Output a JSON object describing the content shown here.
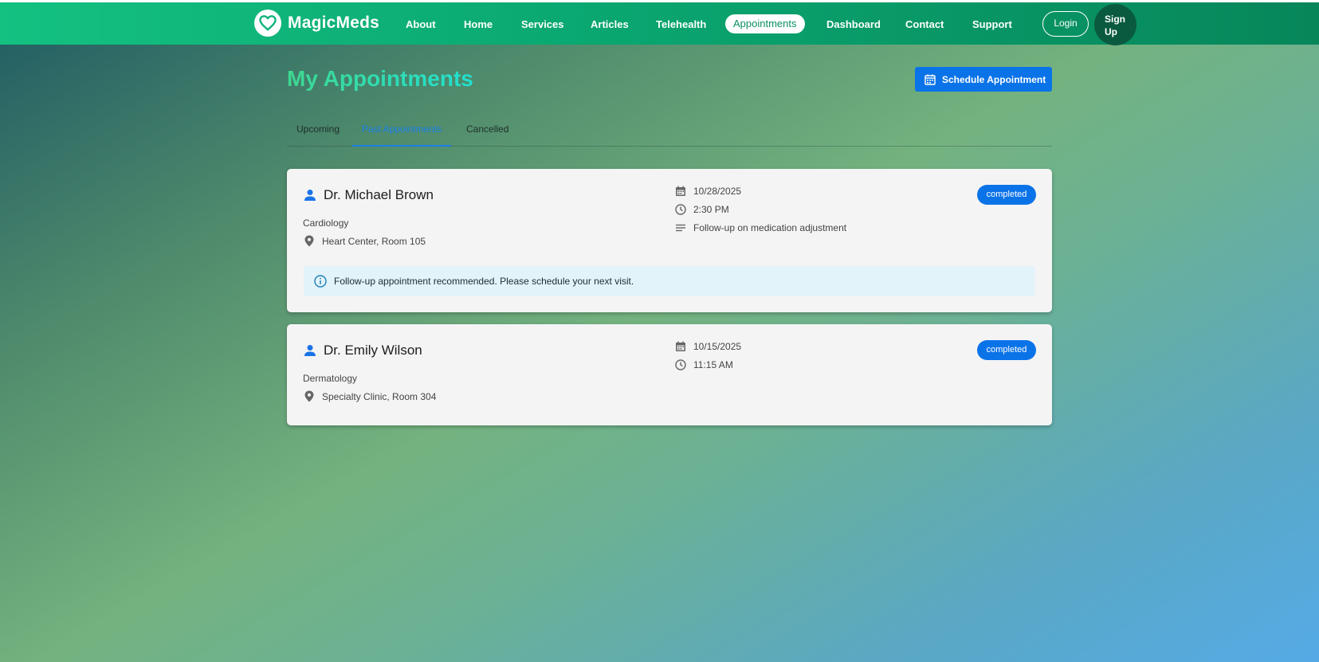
{
  "brand": {
    "name": "MagicMeds",
    "logo_icon": "heart-icon"
  },
  "nav": {
    "links": [
      "About",
      "Home",
      "Services",
      "Articles",
      "Telehealth",
      "Appointments",
      "Dashboard",
      "Contact",
      "Support"
    ],
    "active": "Appointments",
    "login_label": "Login",
    "signup_label_line1": "Sign",
    "signup_label_line2": "Up"
  },
  "page": {
    "title": "My Appointments",
    "schedule_button": "Schedule Appointment",
    "schedule_icon": "calendar-icon"
  },
  "tabs": {
    "items": [
      "Upcoming",
      "Past Appointments",
      "Cancelled"
    ],
    "active": "Past Appointments"
  },
  "appointments": [
    {
      "doctor": "Dr. Michael Brown",
      "specialty": "Cardiology",
      "location": "Heart Center, Room 105",
      "date": "10/28/2025",
      "time": "2:30 PM",
      "reason": "Follow-up on medication adjustment",
      "status": "completed",
      "note": "Follow-up appointment recommended. Please schedule your next visit."
    },
    {
      "doctor": "Dr. Emily Wilson",
      "specialty": "Dermatology",
      "location": "Specialty Clinic, Room 304",
      "date": "10/15/2025",
      "time": "11:15 AM",
      "status": "completed"
    }
  ],
  "colors": {
    "primary": "#0b73e8",
    "nav_green": "#0aa771",
    "title_gradient_start": "#3ed891",
    "title_gradient_end": "#22e0d0",
    "note_bg": "#e3f3fa"
  }
}
